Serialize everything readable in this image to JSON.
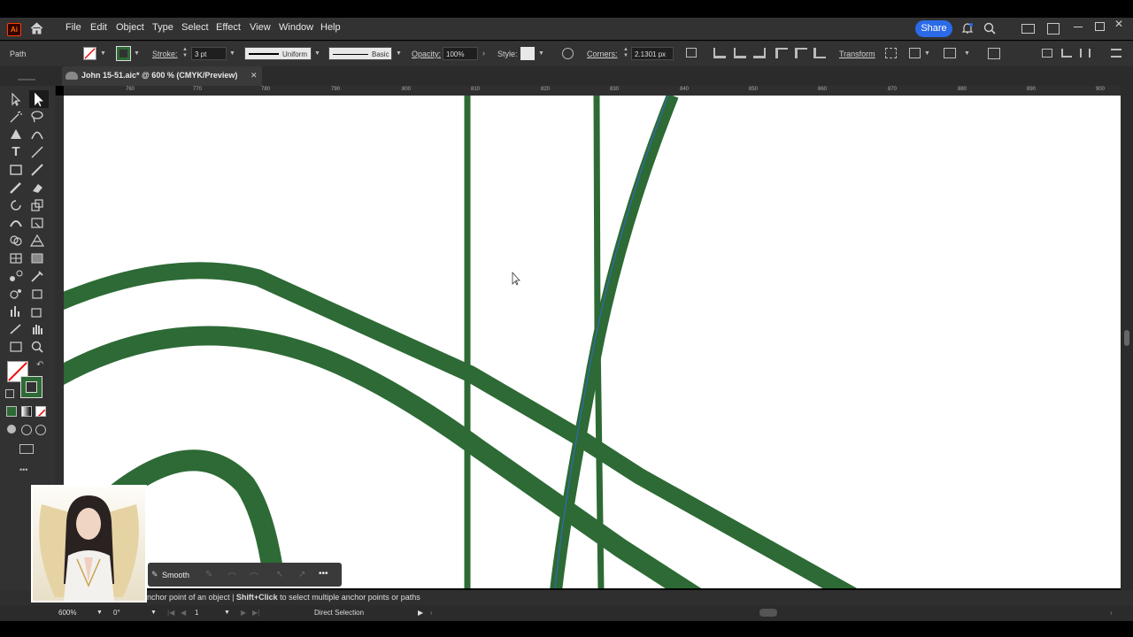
{
  "app": {
    "logo_text": "Ai",
    "accent": "#ff6a00"
  },
  "menu": {
    "items": [
      "File",
      "Edit",
      "Object",
      "Type",
      "Select",
      "Effect",
      "View",
      "Window",
      "Help"
    ],
    "share_label": "Share"
  },
  "control": {
    "selection_type": "Path",
    "stroke_label": "Stroke:",
    "stroke_value": "3 pt",
    "profile_label": "Uniform",
    "brush_label": "Basic",
    "opacity_label": "Opacity:",
    "opacity_value": "100%",
    "style_label": "Style:",
    "corners_label": "Corners:",
    "corners_value": "2.1301 px",
    "transform_label": "Transform",
    "stroke_color": "#2d6a35"
  },
  "document": {
    "tab_title": "John 15-51.aic* @ 600 % (CMYK/Preview)",
    "close_glyph": "✕"
  },
  "ruler": {
    "labels": [
      "760",
      "770",
      "780",
      "790",
      "800",
      "810",
      "820",
      "830",
      "840",
      "850",
      "860",
      "870",
      "880",
      "890",
      "900"
    ]
  },
  "context_toolbar": {
    "smooth_label": "Smooth",
    "more_glyph": "•••"
  },
  "status": {
    "hint_part1": "nchor point of an object  |  ",
    "hint_bold": "Shift+Click",
    "hint_part2": " to select multiple anchor points or paths"
  },
  "bottom": {
    "zoom": "600%",
    "rotation": "0°",
    "artboard": "1",
    "tool_name": "Direct Selection"
  },
  "canvas": {
    "path_color": "#2d6a35",
    "bg": "#ffffff"
  }
}
